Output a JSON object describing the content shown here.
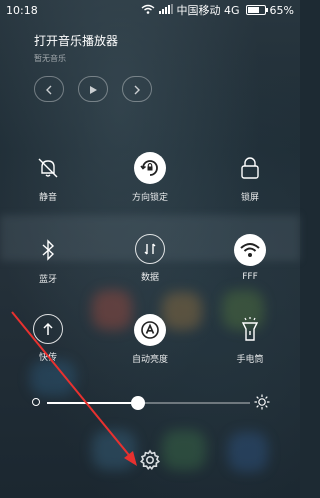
{
  "status_bar": {
    "time": "10:18",
    "carrier": "中国移动 4G",
    "battery": "65%",
    "battery_level": 0.65
  },
  "music": {
    "title": "打开音乐播放器",
    "subtitle": "暂无音乐"
  },
  "toggles": [
    {
      "label": "静音",
      "icon": "bell-off-icon",
      "active": false
    },
    {
      "label": "方向锁定",
      "icon": "rotation-lock-icon",
      "active": true
    },
    {
      "label": "锁屏",
      "icon": "lock-icon",
      "active": false
    },
    {
      "label": "蓝牙",
      "icon": "bluetooth-icon",
      "active": false
    },
    {
      "label": "数据",
      "icon": "mobile-data-icon",
      "active": false
    },
    {
      "label": "FFF",
      "icon": "wifi-icon",
      "active": true
    },
    {
      "label": "快传",
      "icon": "quick-transfer-icon",
      "active": false
    },
    {
      "label": "自动亮度",
      "icon": "auto-brightness-icon",
      "active": true
    },
    {
      "label": "手电筒",
      "icon": "flashlight-icon",
      "active": false
    }
  ],
  "brightness": {
    "level": 0.45
  },
  "colors": {
    "accent": "#ffffff",
    "annotation_arrow": "#e8312f",
    "background": "#1f2d36"
  }
}
